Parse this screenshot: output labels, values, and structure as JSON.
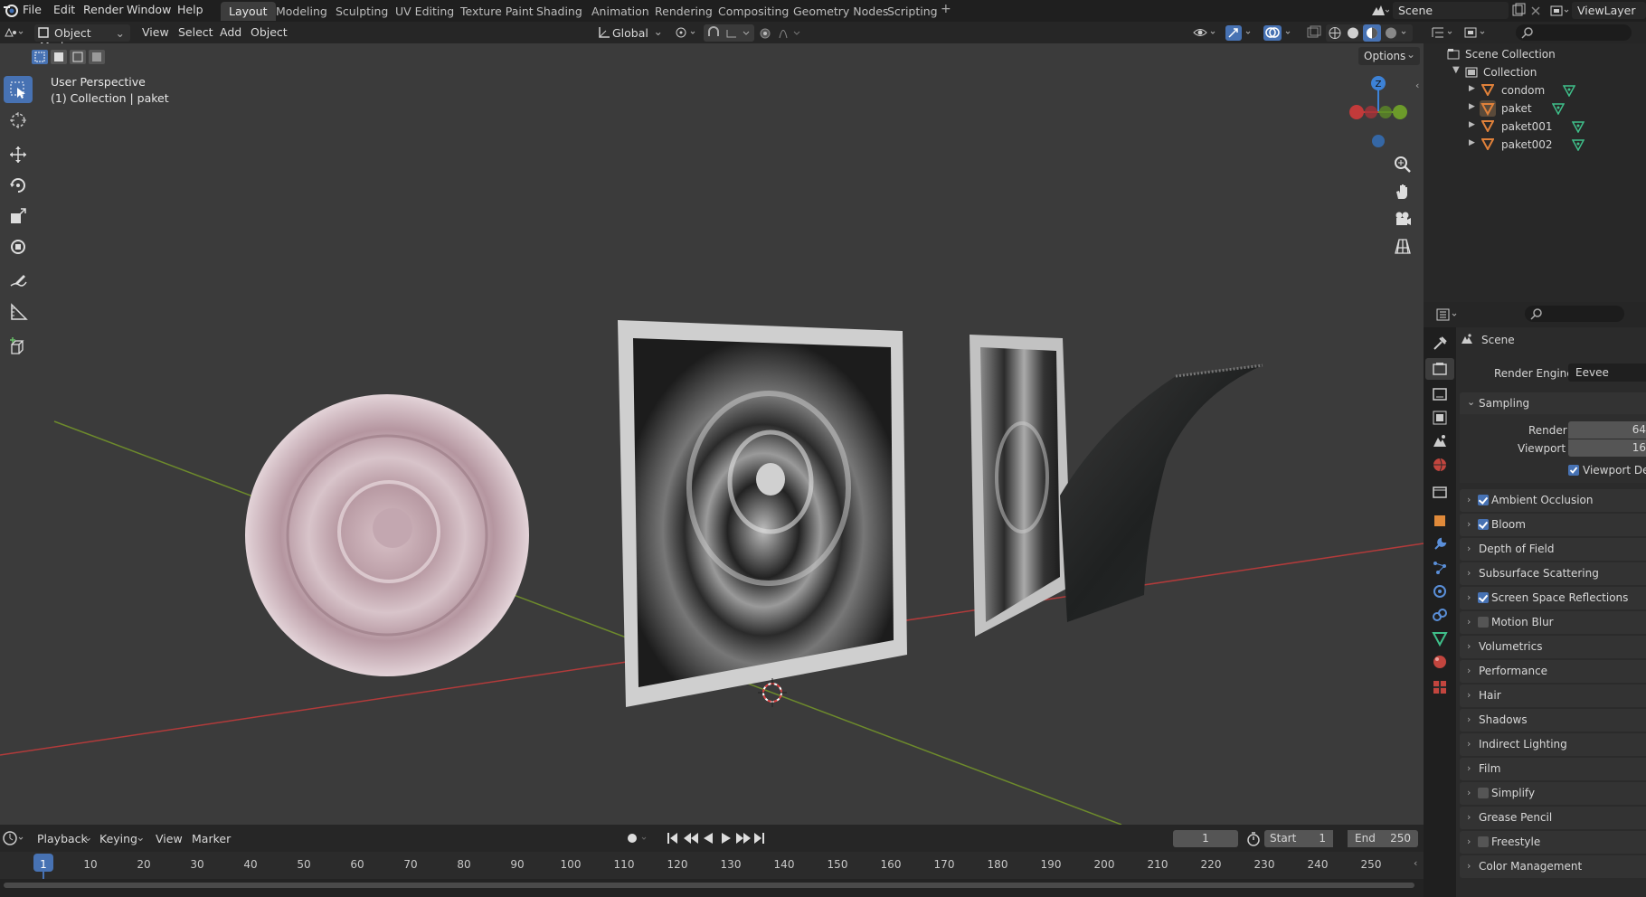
{
  "topbar": {
    "menus": [
      "File",
      "Edit",
      "Render",
      "Window",
      "Help"
    ],
    "workspaces": [
      "Layout",
      "Modeling",
      "Sculpting",
      "UV Editing",
      "Texture Paint",
      "Shading",
      "Animation",
      "Rendering",
      "Compositing",
      "Geometry Nodes",
      "Scripting"
    ],
    "active_workspace": "Layout",
    "add_tab": "+",
    "scene": "Scene",
    "view_layer": "ViewLayer"
  },
  "viewport_header": {
    "mode": "Object Mode",
    "menus": [
      "View",
      "Select",
      "Add",
      "Object"
    ],
    "orientation": "Global",
    "options": "Options"
  },
  "viewport": {
    "perspective": "User Perspective",
    "collection_info": "(1) Collection | paket",
    "gizmo_axis": "Z"
  },
  "outliner": {
    "root": "Scene Collection",
    "collection": "Collection",
    "objects": [
      "condom",
      "paket",
      "paket001",
      "paket002"
    ],
    "selected": "paket"
  },
  "properties": {
    "context": "Scene",
    "render_engine_label": "Render Engine",
    "render_engine": "Eevee",
    "sampling_label": "Sampling",
    "render_label": "Render",
    "render_samples": "64",
    "viewport_label": "Viewport",
    "viewport_samples": "16",
    "viewport_denoise": "Viewport Den",
    "panels": [
      {
        "label": "Ambient Occlusion",
        "checkbox": true,
        "checked": true
      },
      {
        "label": "Bloom",
        "checkbox": true,
        "checked": true
      },
      {
        "label": "Depth of Field",
        "checkbox": false
      },
      {
        "label": "Subsurface Scattering",
        "checkbox": false
      },
      {
        "label": "Screen Space Reflections",
        "checkbox": true,
        "checked": true
      },
      {
        "label": "Motion Blur",
        "checkbox": true,
        "checked": false
      },
      {
        "label": "Volumetrics",
        "checkbox": false
      },
      {
        "label": "Performance",
        "checkbox": false
      },
      {
        "label": "Hair",
        "checkbox": false
      },
      {
        "label": "Shadows",
        "checkbox": false
      },
      {
        "label": "Indirect Lighting",
        "checkbox": false
      },
      {
        "label": "Film",
        "checkbox": false
      },
      {
        "label": "Simplify",
        "checkbox": true,
        "checked": false
      },
      {
        "label": "Grease Pencil",
        "checkbox": false
      },
      {
        "label": "Freestyle",
        "checkbox": true,
        "checked": false
      },
      {
        "label": "Color Management",
        "checkbox": false
      }
    ]
  },
  "timeline": {
    "menus": [
      "Playback",
      "Keying",
      "View",
      "Marker"
    ],
    "current_frame": "1",
    "start_label": "Start",
    "start": "1",
    "end_label": "End",
    "end": "250",
    "ticks": [
      "1",
      "10",
      "20",
      "30",
      "40",
      "50",
      "60",
      "70",
      "80",
      "90",
      "100",
      "110",
      "120",
      "130",
      "140",
      "150",
      "160",
      "170",
      "180",
      "190",
      "200",
      "210",
      "220",
      "230",
      "240",
      "250"
    ]
  },
  "colors": {
    "accent": "#4772b3",
    "viewport_bg": "#3b3b3b",
    "x_axis": "#b23b3b",
    "y_axis": "#6d8a2c",
    "mesh_icon": "#e0813a",
    "data_icon": "#3fbf8a"
  }
}
